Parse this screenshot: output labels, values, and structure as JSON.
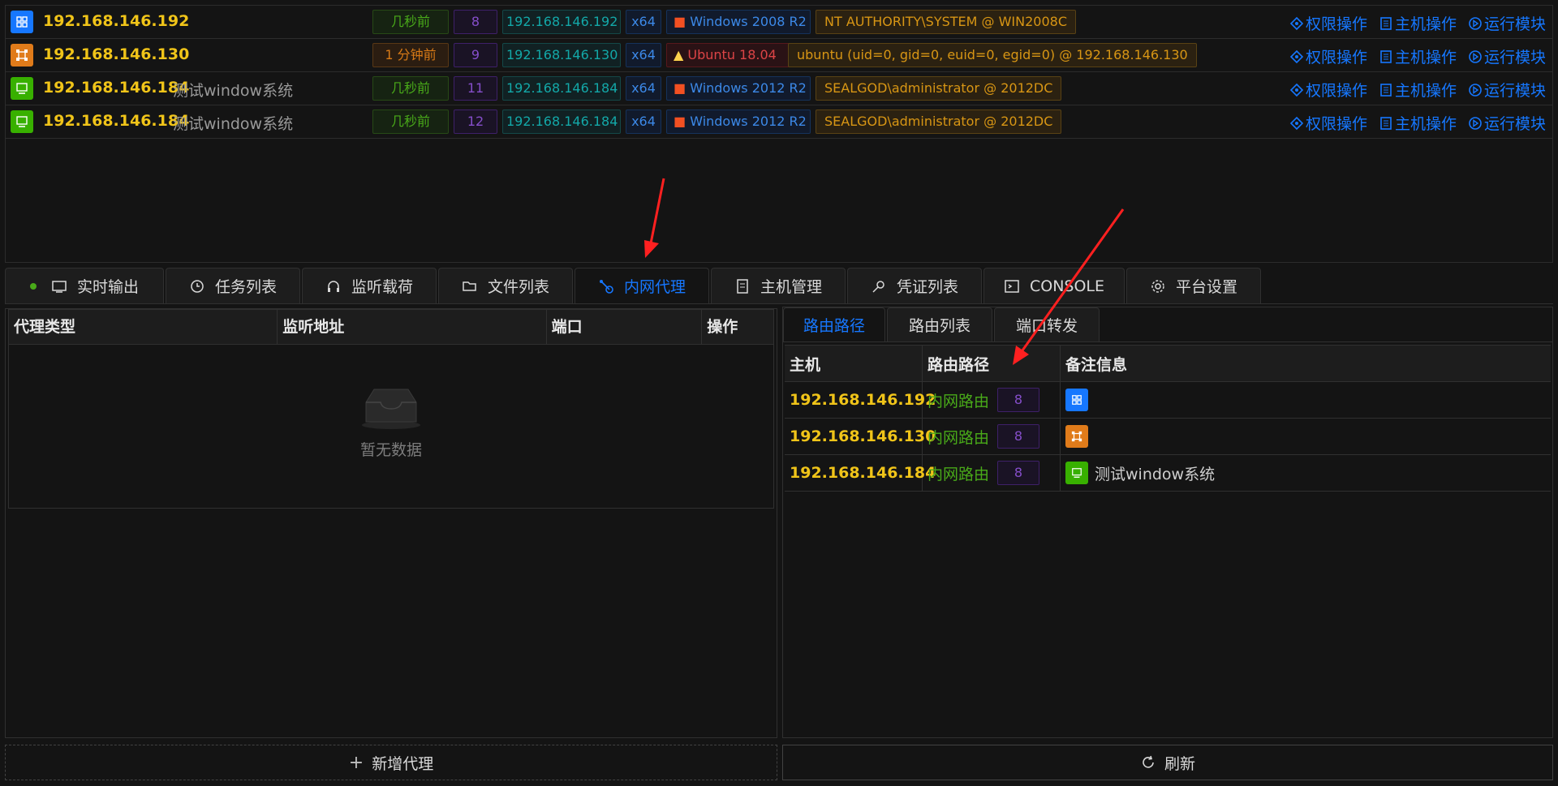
{
  "sessions": [
    {
      "ip": "192.168.146.192",
      "note": "",
      "time": "几秒前",
      "id": "8",
      "ip_tag": "192.168.146.192",
      "arch": "x64",
      "os": "Windows 2008 R2",
      "user": "NT AUTHORITY\\SYSTEM @ WIN2008C",
      "icon": "windows-icon"
    },
    {
      "ip": "192.168.146.130",
      "note": "",
      "time": "1 分钟前",
      "id": "9",
      "ip_tag": "192.168.146.130",
      "arch": "x64",
      "os": "Ubuntu 18.04",
      "user": "ubuntu (uid=0, gid=0, euid=0, egid=0) @ 192.168.146.130",
      "icon": "linux-icon"
    },
    {
      "ip": "192.168.146.184",
      "note": "测试window系统",
      "time": "几秒前",
      "id": "11",
      "ip_tag": "192.168.146.184",
      "arch": "x64",
      "os": "Windows 2012 R2",
      "user": "SEALGOD\\administrator @ 2012DC",
      "icon": "computer-icon"
    },
    {
      "ip": "192.168.146.184",
      "note": "测试window系统",
      "time": "几秒前",
      "id": "12",
      "ip_tag": "192.168.146.184",
      "arch": "x64",
      "os": "Windows 2012 R2",
      "user": "SEALGOD\\administrator @ 2012DC",
      "icon": "computer-icon"
    }
  ],
  "ops": {
    "privilege": "权限操作",
    "host": "主机操作",
    "module": "运行模块"
  },
  "tabs": [
    "实时输出",
    "任务列表",
    "监听载荷",
    "文件列表",
    "内网代理",
    "主机管理",
    "凭证列表",
    "CONSOLE",
    "平台设置"
  ],
  "active_tab": "内网代理",
  "proxy_table": {
    "headers": [
      "代理类型",
      "监听地址",
      "端口",
      "操作"
    ],
    "empty_text": "暂无数据"
  },
  "add_proxy_label": "新增代理",
  "subtabs": [
    "路由路径",
    "路由列表",
    "端口转发"
  ],
  "route_table": {
    "headers": [
      "主机",
      "路由路径",
      "备注信息"
    ],
    "rows": [
      {
        "host": "192.168.146.192",
        "path": "内网路由",
        "id": "8",
        "note": "",
        "icon": "windows-icon"
      },
      {
        "host": "192.168.146.130",
        "path": "内网路由",
        "id": "8",
        "note": "",
        "icon": "linux-icon"
      },
      {
        "host": "192.168.146.184",
        "path": "内网路由",
        "id": "8",
        "note": "测试window系统",
        "icon": "computer-icon"
      }
    ]
  },
  "refresh_label": "刷新",
  "colors": {
    "accent": "#1677ff",
    "ip": "#f0c419",
    "green": "#49aa19",
    "purple": "#854eca",
    "arrow": "#ff2020"
  }
}
